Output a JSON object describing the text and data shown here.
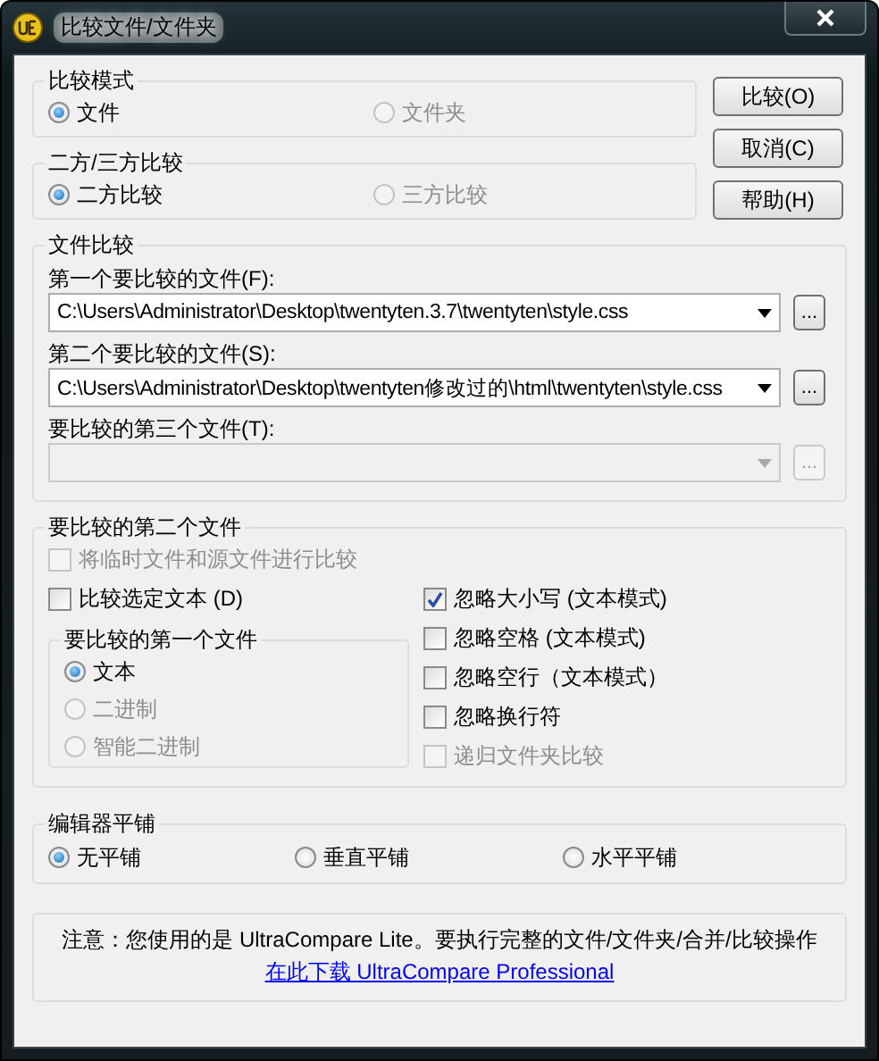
{
  "window": {
    "title": "比较文件/文件夹"
  },
  "compare_mode": {
    "title": "比较模式",
    "options": [
      {
        "label": "文件",
        "selected": true,
        "disabled": false
      },
      {
        "label": "文件夹",
        "selected": false,
        "disabled": true
      }
    ]
  },
  "comparison_way": {
    "title": "二方/三方比较",
    "options": [
      {
        "label": "二方比较",
        "selected": true,
        "disabled": false
      },
      {
        "label": "三方比较",
        "selected": false,
        "disabled": true
      }
    ]
  },
  "buttons": [
    "比较(O)",
    "取消(C)",
    "帮助(H)"
  ],
  "file_compare": {
    "title": "文件比较",
    "fields": [
      {
        "label": "第一个要比较的文件(F):",
        "value": "C:\\Users\\Administrator\\Desktop\\twentyten.3.7\\twentyten\\style.css",
        "disabled": false,
        "browse": "..."
      },
      {
        "label": "第二个要比较的文件(S):",
        "value": "C:\\Users\\Administrator\\Desktop\\twentyten修改过的\\html\\twentyten\\style.css",
        "disabled": false,
        "browse": "..."
      },
      {
        "label": "要比较的第三个文件(T):",
        "disabled": true,
        "browse": "..."
      }
    ]
  },
  "second_file": {
    "title": "要比较的第二个文件",
    "top_options": [
      {
        "label": "将临时文件和源文件进行比较",
        "checked": false,
        "disabled": true
      }
    ],
    "left_options": [
      {
        "label": "比较选定文本 (D)",
        "checked": false,
        "disabled": false
      }
    ],
    "first_file": {
      "title": "要比较的第一个文件",
      "options": [
        {
          "label": "文本",
          "selected": true,
          "disabled": false
        },
        {
          "label": "二进制",
          "selected": false,
          "disabled": true
        },
        {
          "label": "智能二进制",
          "selected": false,
          "disabled": true
        }
      ]
    },
    "right_options": [
      {
        "label": "忽略大小写 (文本模式)",
        "checked": true,
        "disabled": false
      },
      {
        "label": "忽略空格 (文本模式)",
        "checked": false,
        "disabled": false
      },
      {
        "label": "忽略空行（文本模式）",
        "checked": false,
        "disabled": false
      },
      {
        "label": "忽略换行符",
        "checked": false,
        "disabled": false
      },
      {
        "label": "递归文件夹比较",
        "checked": false,
        "disabled": true
      }
    ]
  },
  "tiling": {
    "title": "编辑器平铺",
    "options": [
      {
        "label": "无平铺",
        "selected": true,
        "disabled": false
      },
      {
        "label": "垂直平铺",
        "selected": false,
        "disabled": false
      },
      {
        "label": "水平平铺",
        "selected": false,
        "disabled": false
      }
    ]
  },
  "notice": {
    "text": "注意：您使用的是 UltraCompare Lite。要执行完整的文件/文件夹/合并/比较操作",
    "link": "在此下载 UltraCompare Professional"
  }
}
